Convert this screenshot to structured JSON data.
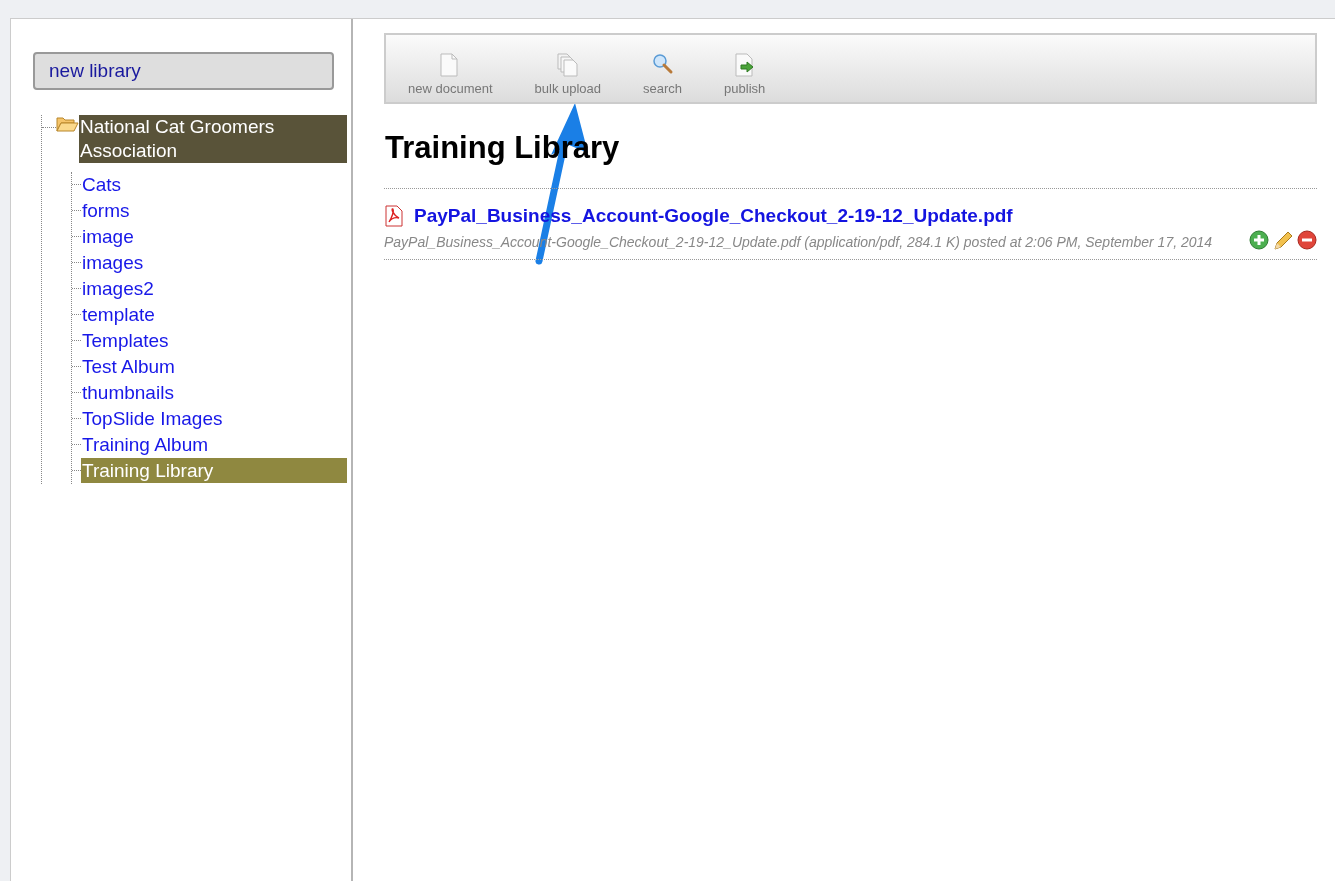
{
  "sidebar": {
    "new_library_button": "new library",
    "tree": [
      {
        "label": "National Cat Groomers Association",
        "selected": true,
        "expanded": true,
        "children": [
          {
            "label": "Cats",
            "selected": false
          },
          {
            "label": "forms",
            "selected": false
          },
          {
            "label": "image",
            "selected": false
          },
          {
            "label": "images",
            "selected": false
          },
          {
            "label": "images2",
            "selected": false
          },
          {
            "label": "template",
            "selected": false
          },
          {
            "label": "Templates",
            "selected": false
          },
          {
            "label": "Test Album",
            "selected": false
          },
          {
            "label": "thumbnails",
            "selected": false
          },
          {
            "label": "TopSlide Images",
            "selected": false
          },
          {
            "label": "Training Album",
            "selected": false
          },
          {
            "label": "Training Library",
            "selected": true
          }
        ]
      }
    ]
  },
  "toolbar": [
    {
      "kind": "document",
      "label": "new document"
    },
    {
      "kind": "copies",
      "label": "bulk upload"
    },
    {
      "kind": "search",
      "label": "search"
    },
    {
      "kind": "publish",
      "label": "publish"
    }
  ],
  "heading": "Training Library",
  "documents": [
    {
      "title": "PayPal_Business_Account-Google_Checkout_2-19-12_Update.pdf",
      "details": "PayPal_Business_Account-Google_Checkout_2-19-12_Update.pdf (application/pdf, 284.1 K) posted at 2:06 PM, September 17, 2014"
    }
  ]
}
